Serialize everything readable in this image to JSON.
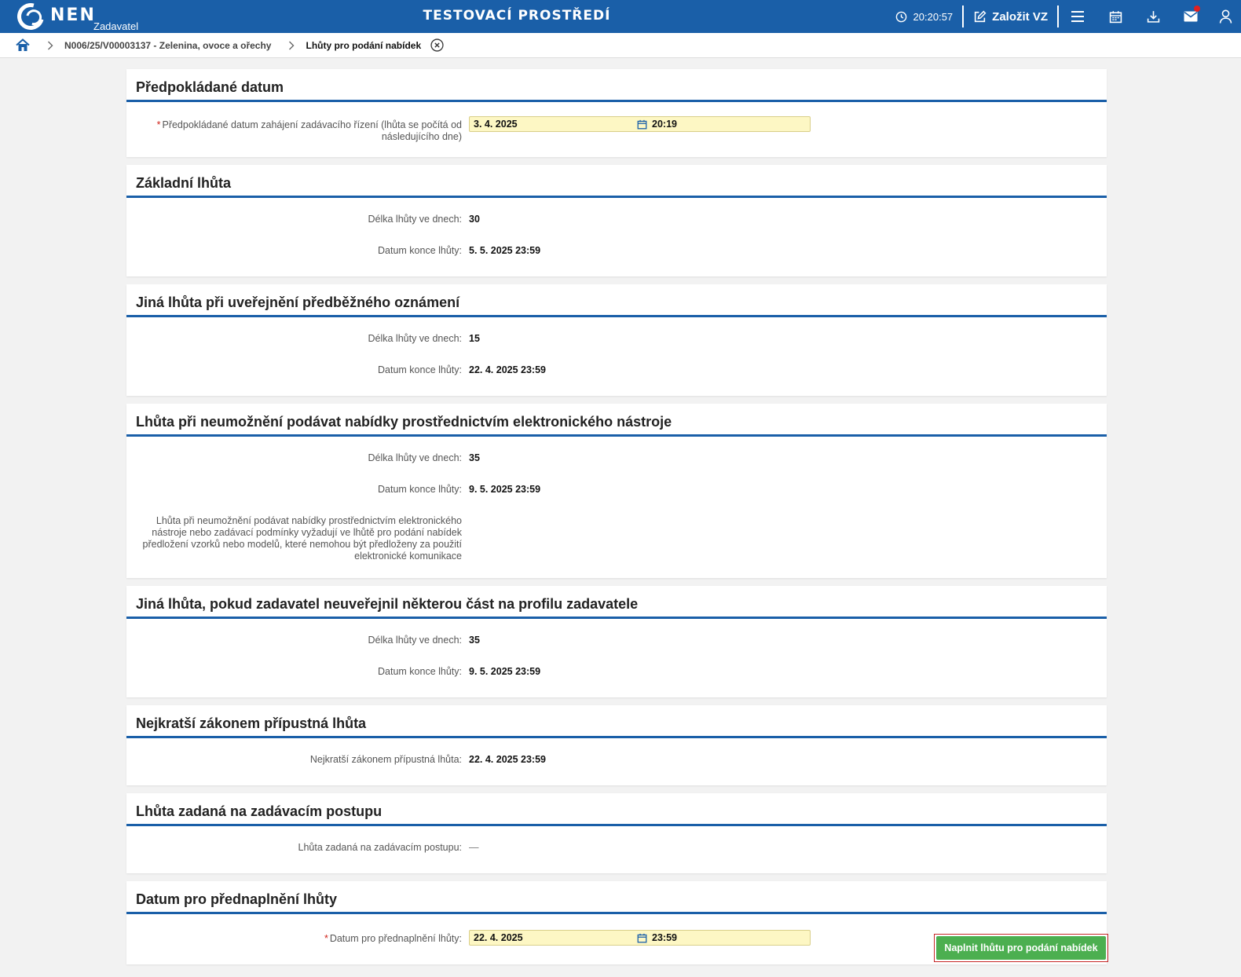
{
  "header": {
    "logo_text": "NEN",
    "logo_sub": "Zadavatel",
    "env_title": "TESTOVACÍ PROSTŘEDÍ",
    "time": "20:20:57",
    "create_label": "Založit VZ"
  },
  "breadcrumb": {
    "items": [
      "N006/25/V00003137 - Zelenina, ovoce a ořechy",
      "Lhůty pro podání nabídek"
    ]
  },
  "sections": {
    "predpokladane": {
      "title": "Předpokládané datum",
      "label": "Předpokládané datum zahájení zadávacího řízení (lhůta se počítá od následujícího dne)",
      "date": "3. 4. 2025",
      "time": "20:19"
    },
    "zakladni": {
      "title": "Základní lhůta",
      "days_label": "Délka lhůty ve dnech:",
      "days": "30",
      "end_label": "Datum konce lhůty:",
      "end": "5. 5. 2025 23:59"
    },
    "jina_predbezne": {
      "title": "Jiná lhůta při uveřejnění předběžného oznámení",
      "days_label": "Délka lhůty ve dnech:",
      "days": "15",
      "end_label": "Datum konce lhůty:",
      "end": "22. 4. 2025 23:59"
    },
    "neumozneni": {
      "title": "Lhůta při neumožnění podávat nabídky prostřednictvím elektronického nástroje",
      "days_label": "Délka lhůty ve dnech:",
      "days": "35",
      "end_label": "Datum konce lhůty:",
      "end": "9. 5. 2025 23:59",
      "note": "Lhůta při neumožnění podávat nabídky prostřednictvím elektronického nástroje nebo zadávací podmínky vyžadují ve lhůtě pro podání nabídek předložení vzorků nebo modelů, které nemohou být předloženy za použití elektronické komunikace"
    },
    "jina_profil": {
      "title": "Jiná lhůta, pokud zadavatel neuveřejnil některou část na profilu zadavatele",
      "days_label": "Délka lhůty ve dnech:",
      "days": "35",
      "end_label": "Datum konce lhůty:",
      "end": "9. 5. 2025 23:59"
    },
    "nejkratsi": {
      "title": "Nejkratší zákonem přípustná lhůta",
      "label": "Nejkratší zákonem přípustná lhůta:",
      "value": "22. 4. 2025 23:59"
    },
    "zadana": {
      "title": "Lhůta zadaná na zadávacím postupu",
      "label": "Lhůta zadaná na zadávacím postupu:",
      "value": "—"
    },
    "prednaplneni": {
      "title": "Datum pro přednaplnění lhůty",
      "label": "Datum pro přednaplnění lhůty:",
      "date": "22. 4. 2025",
      "time": "23:59"
    }
  },
  "actions": {
    "fill_button": "Naplnit lhůtu pro podání nabídek"
  },
  "colors": {
    "header_blue": "#1a5fa8",
    "button_green": "#4caf50",
    "required_red": "#d0241b",
    "input_yellow": "#fdf7c4"
  }
}
